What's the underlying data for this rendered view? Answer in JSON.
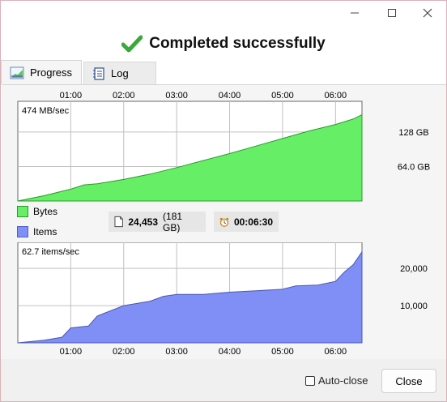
{
  "window": {
    "controls": {
      "minimize": "minimize-icon",
      "maximize": "maximize-icon",
      "close": "close-icon"
    }
  },
  "header": {
    "text": "Completed successfully",
    "icon": "check-icon",
    "icon_color": "#3aa83a"
  },
  "tabs": [
    {
      "label": "Progress",
      "icon": "chart-icon",
      "active": true
    },
    {
      "label": "Log",
      "icon": "notebook-icon",
      "active": false
    }
  ],
  "top_chart": {
    "rate_label": "474 MB/sec",
    "time_ticks": [
      "01:00",
      "02:00",
      "03:00",
      "04:00",
      "05:00",
      "06:00"
    ],
    "y_ticks": [
      "128 GB",
      "64.0 GB"
    ]
  },
  "legend": {
    "bytes": {
      "label": "Bytes",
      "color": "#66ef66"
    },
    "items": {
      "label": "Items",
      "color": "#7f8ff5"
    }
  },
  "stats": {
    "count": "24,453",
    "size": "(181 GB)",
    "elapsed": "00:06:30",
    "file_icon": "file-icon",
    "clock_icon": "alarm-clock-icon"
  },
  "bottom_chart": {
    "rate_label": "62.7 items/sec",
    "time_ticks": [
      "01:00",
      "02:00",
      "03:00",
      "04:00",
      "05:00",
      "06:00"
    ],
    "y_ticks": [
      "20,000",
      "10,000"
    ]
  },
  "footer": {
    "autoclose_label": "Auto-close",
    "autoclose_checked": false,
    "close_label": "Close"
  },
  "chart_data": [
    {
      "type": "area",
      "series": [
        {
          "name": "Bytes",
          "color": "#66ef66",
          "x": [
            "00:00",
            "00:30",
            "01:00",
            "01:15",
            "01:30",
            "02:00",
            "02:30",
            "03:00",
            "03:30",
            "04:00",
            "04:30",
            "05:00",
            "05:30",
            "06:00",
            "06:20",
            "06:30"
          ],
          "values": [
            0,
            10,
            22,
            30,
            32,
            40,
            50,
            62,
            75,
            88,
            102,
            116,
            130,
            142,
            152,
            160
          ]
        }
      ],
      "y_unit": "GB",
      "y_ticks": [
        64,
        128
      ],
      "ylim": [
        0,
        185
      ],
      "xlim_minutes": [
        0,
        6.5
      ],
      "grid": true
    },
    {
      "type": "area",
      "series": [
        {
          "name": "Items",
          "color": "#7f8ff5",
          "x": [
            "00:00",
            "00:30",
            "00:50",
            "01:00",
            "01:20",
            "01:30",
            "02:00",
            "02:30",
            "02:45",
            "03:00",
            "03:30",
            "04:00",
            "04:30",
            "05:00",
            "05:15",
            "05:40",
            "06:00",
            "06:10",
            "06:20",
            "06:30"
          ],
          "values": [
            0,
            700,
            1500,
            4000,
            4500,
            7200,
            10000,
            11200,
            12500,
            13000,
            13000,
            13600,
            14000,
            14400,
            15300,
            15500,
            16500,
            19000,
            21000,
            24453
          ]
        }
      ],
      "y_ticks": [
        10000,
        20000
      ],
      "ylim": [
        0,
        27000
      ],
      "xlim_minutes": [
        0,
        6.5
      ],
      "grid": true
    }
  ]
}
